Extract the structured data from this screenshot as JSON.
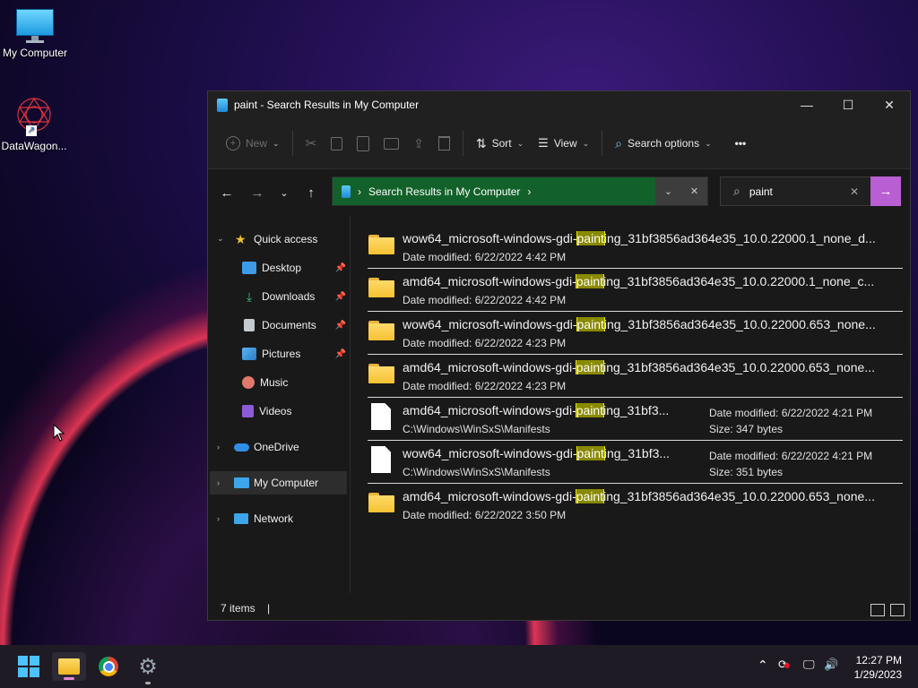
{
  "desktop": {
    "icons": [
      {
        "label": "My Computer"
      },
      {
        "label": "DataWagon..."
      }
    ]
  },
  "window": {
    "title": "paint - Search Results in My Computer",
    "controls": {
      "minimize": "—",
      "maximize": "☐",
      "close": "✕"
    },
    "commandbar": {
      "new_label": "New",
      "sort_label": "Sort",
      "view_label": "View",
      "search_options_label": "Search options",
      "more_label": "•••"
    },
    "address": {
      "path_label": "Search Results in My Computer",
      "sep": "›"
    },
    "search": {
      "value": "paint",
      "clear": "✕",
      "go": "→"
    },
    "sidebar": {
      "quick_access": "Quick access",
      "items": [
        {
          "label": "Desktop"
        },
        {
          "label": "Downloads"
        },
        {
          "label": "Documents"
        },
        {
          "label": "Pictures"
        },
        {
          "label": "Music"
        },
        {
          "label": "Videos"
        }
      ],
      "onedrive": "OneDrive",
      "my_computer": "My Computer",
      "network": "Network"
    },
    "results": [
      {
        "pre": "wow64_microsoft-windows-gdi-",
        "hl": "paint",
        "post": "ing_31bf3856ad364e35_10.0.22000.1_none_d...",
        "meta": "Date modified: 6/22/2022 4:42 PM"
      },
      {
        "pre": "amd64_microsoft-windows-gdi-",
        "hl": "paint",
        "post": "ing_31bf3856ad364e35_10.0.22000.1_none_c...",
        "meta": "Date modified: 6/22/2022 4:42 PM"
      },
      {
        "pre": "wow64_microsoft-windows-gdi-",
        "hl": "paint",
        "post": "ing_31bf3856ad364e35_10.0.22000.653_none...",
        "meta": "Date modified: 6/22/2022 4:23 PM"
      },
      {
        "pre": "amd64_microsoft-windows-gdi-",
        "hl": "paint",
        "post": "ing_31bf3856ad364e35_10.0.22000.653_none...",
        "meta": "Date modified: 6/22/2022 4:23 PM"
      },
      {
        "pre": "amd64_microsoft-windows-gdi-",
        "hl": "paint",
        "post": "ing_31bf3...",
        "meta": "C:\\Windows\\WinSxS\\Manifests",
        "date": "Date modified: 6/22/2022 4:21 PM",
        "size": "Size: 347 bytes"
      },
      {
        "pre": "wow64_microsoft-windows-gdi-",
        "hl": "paint",
        "post": "ing_31bf3...",
        "meta": "C:\\Windows\\WinSxS\\Manifests",
        "date": "Date modified: 6/22/2022 4:21 PM",
        "size": "Size: 351 bytes"
      },
      {
        "pre": "amd64_microsoft-windows-gdi-",
        "hl": "paint",
        "post": "ing_31bf3856ad364e35_10.0.22000.653_none...",
        "meta": "Date modified: 6/22/2022 3:50 PM"
      }
    ],
    "status": {
      "items": "7 items"
    }
  },
  "taskbar": {
    "clock_time": "12:27 PM",
    "clock_date": "1/29/2023"
  }
}
